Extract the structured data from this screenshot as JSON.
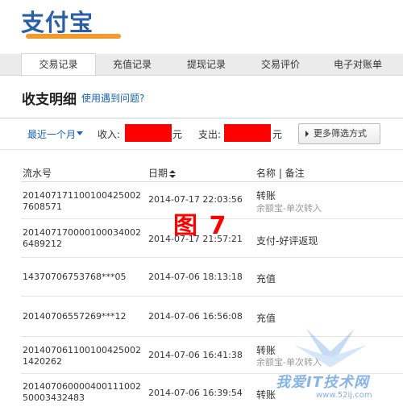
{
  "brand": {
    "logo_text": "支付宝"
  },
  "nav": {
    "tabs": [
      {
        "label": "交易记录",
        "active": true
      },
      {
        "label": "充值记录",
        "active": false
      },
      {
        "label": "提现记录",
        "active": false
      },
      {
        "label": "交易评价",
        "active": false
      },
      {
        "label": "电子对账单",
        "active": false
      }
    ]
  },
  "header": {
    "title": "收支明细",
    "help_link": "使用遇到问题?"
  },
  "filter": {
    "range": "最近一个月",
    "income_label": "收入:",
    "income_unit": "元",
    "expense_label": "支出:",
    "expense_unit": "元",
    "more_button": "更多筛选方式"
  },
  "table": {
    "columns": {
      "serial": "流水号",
      "date": "日期",
      "name": "名称 | 备注"
    },
    "rows": [
      {
        "serial": "2014071711001004250027608571",
        "date": "2014-07-17 22:03:56",
        "name": "转账",
        "note": "余额宝-单次转入"
      },
      {
        "serial": "2014071700001000340026489212",
        "date": "2014-07-17 21:57:21",
        "name": "支付-好评返现",
        "note": ""
      },
      {
        "serial": "14370706753768***05",
        "date": "2014-07-06 18:13:18",
        "name": "充值",
        "note": ""
      },
      {
        "serial": "20140706557269***12",
        "date": "2014-07-06 16:56:08",
        "name": "充值",
        "note": ""
      },
      {
        "serial": "2014070611001004250021420262",
        "date": "2014-07-06 16:41:38",
        "name": "转账",
        "note": "余额宝-单次转入"
      },
      {
        "serial": "20140706000040011100250003432483",
        "date": "2014-07-06 16:39:54",
        "name": "转账",
        "note": ""
      }
    ]
  },
  "overlays": {
    "figure_label": "图 7",
    "site_watermark": "我爱IT技术网",
    "site_url": "www.52ij.com"
  },
  "colors": {
    "link": "#1a64b8",
    "redaction": "#ff0000",
    "brand_blue": "#2a5ea8",
    "brand_orange": "#f29a2e"
  }
}
